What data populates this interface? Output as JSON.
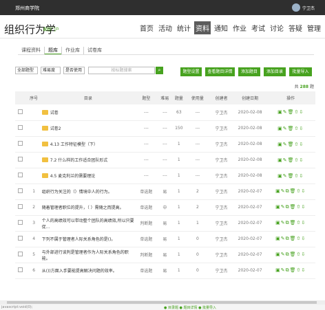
{
  "topbar": {
    "site": "郑州商学院",
    "user": "宁卫杰"
  },
  "header": {
    "title": "组织行为学",
    "sub": "课程门户",
    "nav": [
      "首页",
      "活动",
      "统计",
      "资料",
      "通知",
      "作业",
      "考试",
      "讨论",
      "答疑",
      "管理"
    ],
    "active_nav": "资料"
  },
  "tabs": [
    "课程资料",
    "题库",
    "作业库",
    "试卷库"
  ],
  "active_tab": "题库",
  "filters": {
    "type": "全部题型",
    "difficulty": "难易度",
    "used": "是否使用",
    "search_placeholder": "按标题搜索"
  },
  "buttons": [
    "题型设置",
    "查看题目详情",
    "添加题目",
    "添加目录",
    "批量导入"
  ],
  "count": {
    "prefix": "共",
    "value": "288",
    "suffix": "题"
  },
  "table": {
    "headers": [
      "序号",
      "目录",
      "题型",
      "难易",
      "题量",
      "使用量",
      "创建者",
      "创建日期",
      "操作"
    ],
    "rows": [
      {
        "no": "",
        "title": "试卷",
        "type": "---",
        "diff": "---",
        "qty": "63",
        "used": "---",
        "creator": "宁卫杰",
        "date": "2020-02-08",
        "folder": true
      },
      {
        "no": "",
        "title": "试卷2",
        "type": "---",
        "diff": "---",
        "qty": "150",
        "used": "---",
        "creator": "宁卫杰",
        "date": "2020-02-08",
        "folder": true
      },
      {
        "no": "",
        "title": "4.13 工作特征模型（下）",
        "type": "---",
        "diff": "---",
        "qty": "1",
        "used": "---",
        "creator": "宁卫杰",
        "date": "2020-02-08",
        "folder": true
      },
      {
        "no": "",
        "title": "7.2 什么样的工作适合团队形式",
        "type": "---",
        "diff": "---",
        "qty": "1",
        "used": "---",
        "creator": "宁卫杰",
        "date": "2020-02-08",
        "folder": true
      },
      {
        "no": "",
        "title": "4.5 麦克利兰的需要理论",
        "type": "---",
        "diff": "---",
        "qty": "1",
        "used": "---",
        "creator": "宁卫杰",
        "date": "2020-02-08",
        "folder": true
      },
      {
        "no": "1",
        "title": "组织行为关注的（）情境中人的行为。",
        "type": "单选题",
        "diff": "易",
        "qty": "1",
        "used": "2",
        "creator": "宁卫杰",
        "date": "2020-02-07",
        "folder": false
      },
      {
        "no": "2",
        "title": "随着管理者职位的提升，（ ）需随之而提高。",
        "type": "单选题",
        "diff": "中",
        "qty": "1",
        "used": "2",
        "creator": "宁卫杰",
        "date": "2020-02-07",
        "folder": false
      },
      {
        "no": "3",
        "title": "个人的高绩效可以带动整个团队的高绩效,所以只要促...",
        "type": "判断题",
        "diff": "易",
        "qty": "1",
        "used": "1",
        "creator": "宁卫杰",
        "date": "2020-02-07",
        "folder": false
      },
      {
        "no": "4",
        "title": "下列不属于管理者人际关系角色的是()。",
        "type": "单选题",
        "diff": "易",
        "qty": "1",
        "used": "0",
        "creator": "宁卫杰",
        "date": "2020-02-07",
        "folder": false
      },
      {
        "no": "5",
        "title": "与外部进行谈判是管理者作为人际关系角色的职能。",
        "type": "判断题",
        "diff": "易",
        "qty": "1",
        "used": "0",
        "creator": "宁卫杰",
        "date": "2020-02-07",
        "folder": false
      },
      {
        "no": "6",
        "title": "从())方面入手要能提高解决问题的效率。",
        "type": "单选题",
        "diff": "易",
        "qty": "1",
        "used": "0",
        "creator": "宁卫杰",
        "date": "2020-02-07",
        "folder": false
      }
    ]
  },
  "status": {
    "url": "javascript:void(0);",
    "legend": "● 目录题   ● 题目详情   ● 批量导入"
  }
}
